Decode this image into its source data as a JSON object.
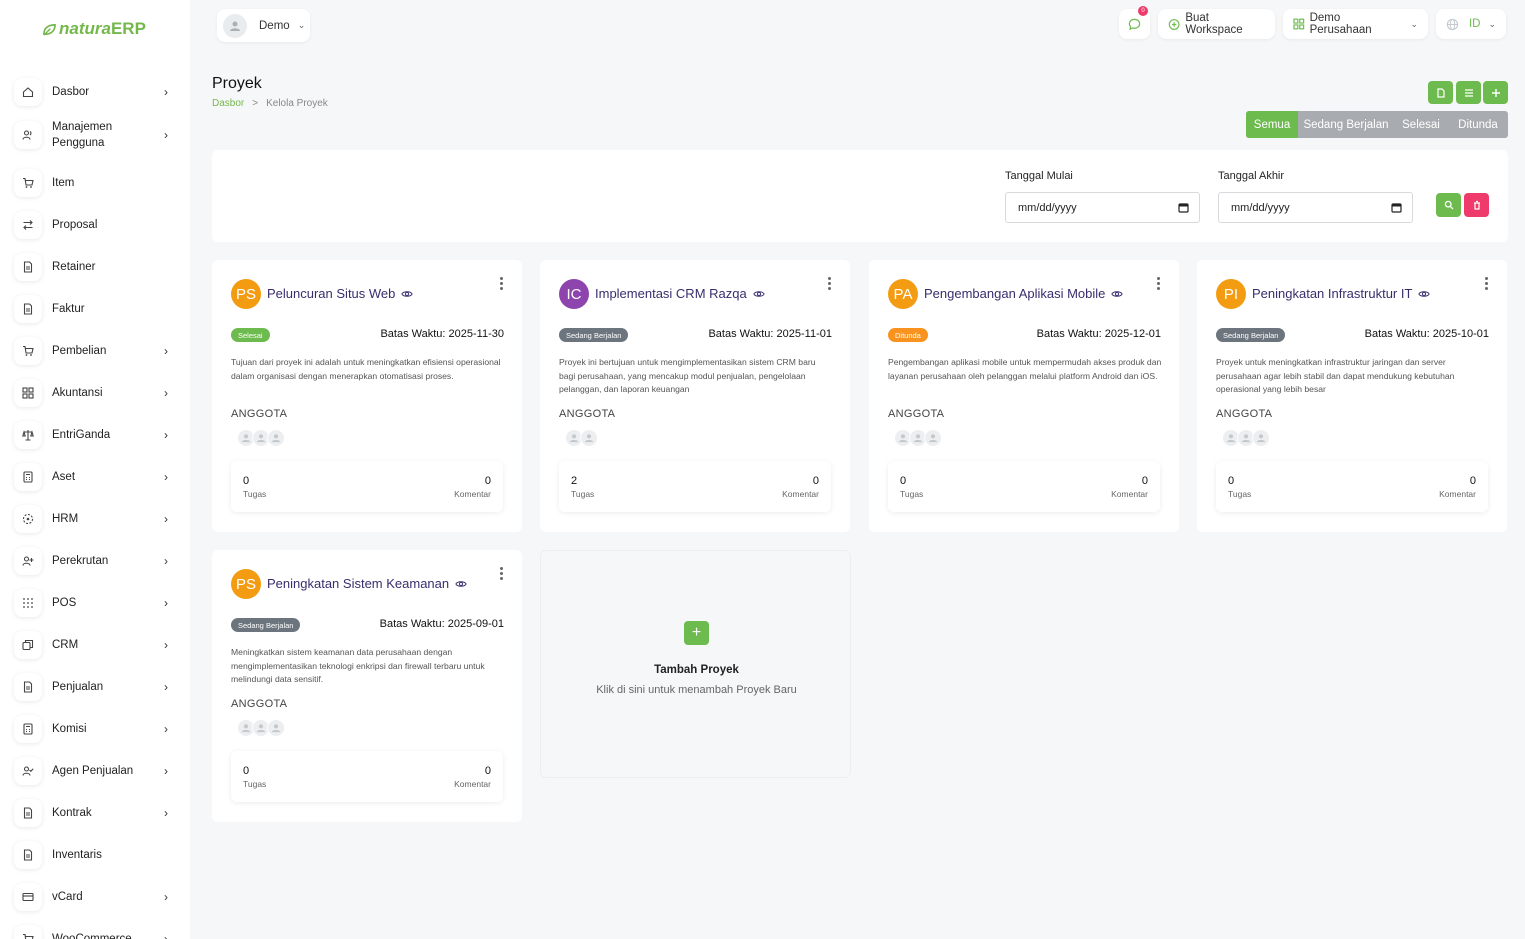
{
  "app": {
    "logo_part1": "natura",
    "logo_part2": "ERP"
  },
  "sidebar": {
    "items": [
      {
        "label": "Dasbor",
        "icon": "home-icon",
        "chevron": true
      },
      {
        "label": "Manajemen Pengguna",
        "icon": "users-icon",
        "chevron": true
      },
      {
        "label": "Item",
        "icon": "cart-icon",
        "chevron": false
      },
      {
        "label": "Proposal",
        "icon": "swap-icon",
        "chevron": false
      },
      {
        "label": "Retainer",
        "icon": "doc-icon",
        "chevron": false
      },
      {
        "label": "Faktur",
        "icon": "doc-icon",
        "chevron": false
      },
      {
        "label": "Pembelian",
        "icon": "cart-icon",
        "chevron": true
      },
      {
        "label": "Akuntansi",
        "icon": "grid-icon",
        "chevron": true
      },
      {
        "label": "EntriGanda",
        "icon": "scale-icon",
        "chevron": true
      },
      {
        "label": "Aset",
        "icon": "calculator-icon",
        "chevron": true
      },
      {
        "label": "HRM",
        "icon": "target-icon",
        "chevron": true
      },
      {
        "label": "Perekrutan",
        "icon": "user-plus-icon",
        "chevron": true
      },
      {
        "label": "POS",
        "icon": "dots-grid-icon",
        "chevron": true
      },
      {
        "label": "CRM",
        "icon": "layers-icon",
        "chevron": true
      },
      {
        "label": "Penjualan",
        "icon": "doc-icon",
        "chevron": true
      },
      {
        "label": "Komisi",
        "icon": "calculator-icon",
        "chevron": true
      },
      {
        "label": "Agen Penjualan",
        "icon": "user-check-icon",
        "chevron": true
      },
      {
        "label": "Kontrak",
        "icon": "doc-icon",
        "chevron": true
      },
      {
        "label": "Inventaris",
        "icon": "doc-icon",
        "chevron": false
      },
      {
        "label": "vCard",
        "icon": "card-icon",
        "chevron": true
      },
      {
        "label": "WooCommerce",
        "icon": "cart-icon",
        "chevron": true
      }
    ]
  },
  "topbar": {
    "user_name": "Demo",
    "notification_count": "0",
    "create_workspace": "Buat Workspace",
    "company": "Demo Perusahaan",
    "language": "ID"
  },
  "header": {
    "title": "Proyek",
    "breadcrumb_home": "Dasbor",
    "breadcrumb_sep": ">",
    "breadcrumb_current": "Kelola Proyek"
  },
  "status_tabs": [
    {
      "label": "Semua",
      "active": true
    },
    {
      "label": "Sedang Berjalan",
      "active": false
    },
    {
      "label": "Selesai",
      "active": false
    },
    {
      "label": "Ditunda",
      "active": false
    }
  ],
  "filter": {
    "start_label": "Tanggal Mulai",
    "start_placeholder": "mm/dd/yyyy",
    "end_label": "Tanggal Akhir",
    "end_placeholder": "mm/dd/yyyy"
  },
  "labels": {
    "deadline_prefix": "Batas Waktu:",
    "members": "ANGGOTA",
    "tasks": "Tugas",
    "comments": "Komentar"
  },
  "projects": [
    {
      "initials": "PS",
      "avatar_color": "#f39c12",
      "title": "Peluncuran Situs Web",
      "status": "Selesai",
      "status_color": "#6dbb4e",
      "deadline": "2025-11-30",
      "description": "Tujuan dari proyek ini adalah untuk meningkatkan efisiensi operasional dalam organisasi dengan menerapkan otomatisasi proses.",
      "member_count": 3,
      "tasks": "0",
      "comments": "0"
    },
    {
      "initials": "IC",
      "avatar_color": "#8e44ad",
      "title": "Implementasi CRM Razqa",
      "status": "Sedang Berjalan",
      "status_color": "#6c757d",
      "deadline": "2025-11-01",
      "description": "Proyek ini bertujuan untuk mengimplementasikan sistem CRM baru bagi perusahaan, yang mencakup modul penjualan, pengelolaan pelanggan, dan laporan keuangan",
      "member_count": 2,
      "tasks": "2",
      "comments": "0"
    },
    {
      "initials": "PA",
      "avatar_color": "#f39c12",
      "title": "Pengembangan Aplikasi Mobile",
      "status": "Ditunda",
      "status_color": "#f7931e",
      "deadline": "2025-12-01",
      "description": "Pengembangan aplikasi mobile untuk mempermudah akses produk dan layanan perusahaan oleh pelanggan melalui platform Android dan iOS.",
      "member_count": 3,
      "tasks": "0",
      "comments": "0"
    },
    {
      "initials": "PI",
      "avatar_color": "#f39c12",
      "title": "Peningkatan Infrastruktur IT",
      "status": "Sedang Berjalan",
      "status_color": "#6c757d",
      "deadline": "2025-10-01",
      "description": "Proyek untuk meningkatkan infrastruktur jaringan dan server perusahaan agar lebih stabil dan dapat mendukung kebutuhan operasional yang lebih besar",
      "member_count": 3,
      "tasks": "0",
      "comments": "0"
    },
    {
      "initials": "PS",
      "avatar_color": "#f39c12",
      "title": "Peningkatan Sistem Keamanan",
      "status": "Sedang Berjalan",
      "status_color": "#6c757d",
      "deadline": "2025-09-01",
      "description": "Meningkatkan sistem keamanan data perusahaan dengan mengimplementasikan teknologi enkripsi dan firewall terbaru untuk melindungi data sensitif.",
      "member_count": 3,
      "tasks": "0",
      "comments": "0"
    }
  ],
  "add_project": {
    "title": "Tambah Proyek",
    "subtitle": "Klik di sini untuk menambah Proyek Baru"
  },
  "colors": {
    "accent": "#6dbb4e",
    "danger": "#ee3b6b",
    "title_text": "#3a2d6e"
  }
}
